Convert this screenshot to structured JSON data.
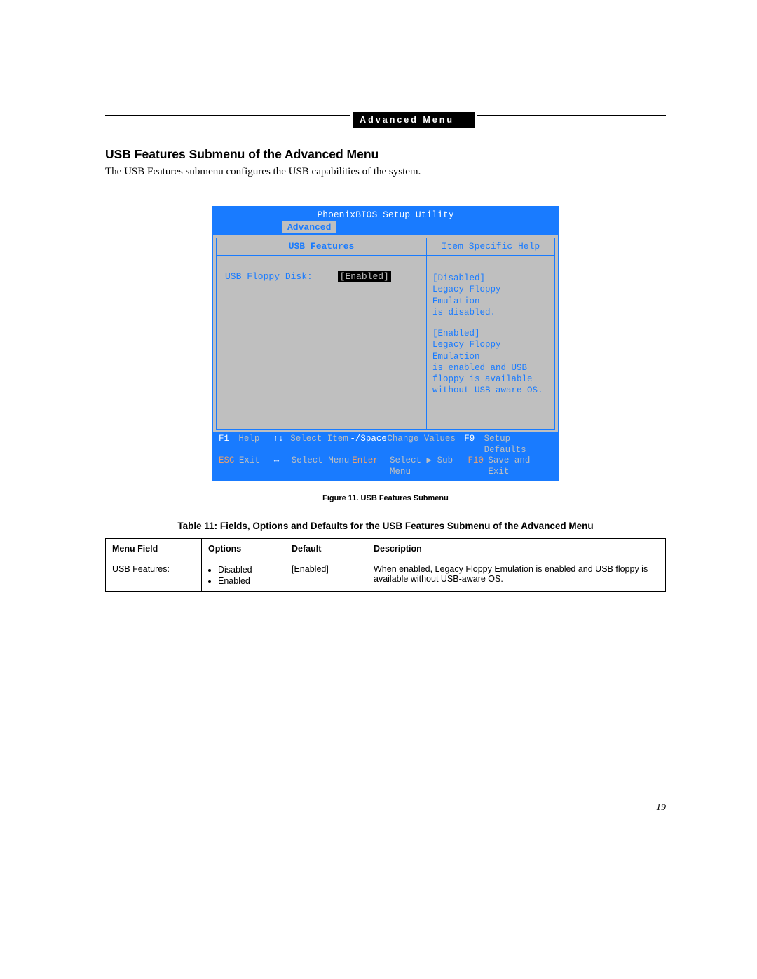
{
  "header": {
    "badge": "Advanced Menu"
  },
  "section": {
    "title": "USB Features Submenu of the Advanced Menu",
    "intro": "The USB Features submenu configures the USB capabilities of the system."
  },
  "bios": {
    "title": "PhoenixBIOS Setup Utility",
    "tab": "Advanced",
    "left_title": "USB Features",
    "field_label": "USB Floppy Disk:",
    "field_value": "[Enabled]",
    "right_title": "Item Specific Help",
    "help": {
      "d1": "[Disabled]",
      "d2": "Legacy Floppy Emulation",
      "d3": "is disabled.",
      "e1": "[Enabled]",
      "e2": "Legacy Floppy Emulation",
      "e3": "is enabled and USB",
      "e4": "floppy is available",
      "e5": "without USB aware OS."
    },
    "footer": {
      "r1": {
        "k1": "F1",
        "l1": "Help",
        "k2": "↑↓",
        "l2": "Select Item",
        "k3": "-/Space",
        "l3": "Change Values",
        "k4": "F9",
        "l4": "Setup Defaults"
      },
      "r2": {
        "k1": "ESC",
        "l1": "Exit",
        "k2": "↔",
        "l2": "Select Menu",
        "k3": "Enter",
        "l3": "Select ▶ Sub-Menu",
        "k4": "F10",
        "l4": "Save and Exit"
      }
    }
  },
  "figure_caption": "Figure 11.  USB Features Submenu",
  "table_title": "Table 11: Fields, Options and Defaults for the USB Features Submenu of the Advanced Menu",
  "table": {
    "headers": {
      "c1": "Menu Field",
      "c2": "Options",
      "c3": "Default",
      "c4": "Description"
    },
    "row": {
      "menu_field": "USB Features:",
      "options": {
        "o1": "Disabled",
        "o2": "Enabled"
      },
      "default": "[Enabled]",
      "description": "When enabled, Legacy Floppy Emulation is enabled and USB floppy is available without USB-aware OS."
    }
  },
  "page_number": "19"
}
